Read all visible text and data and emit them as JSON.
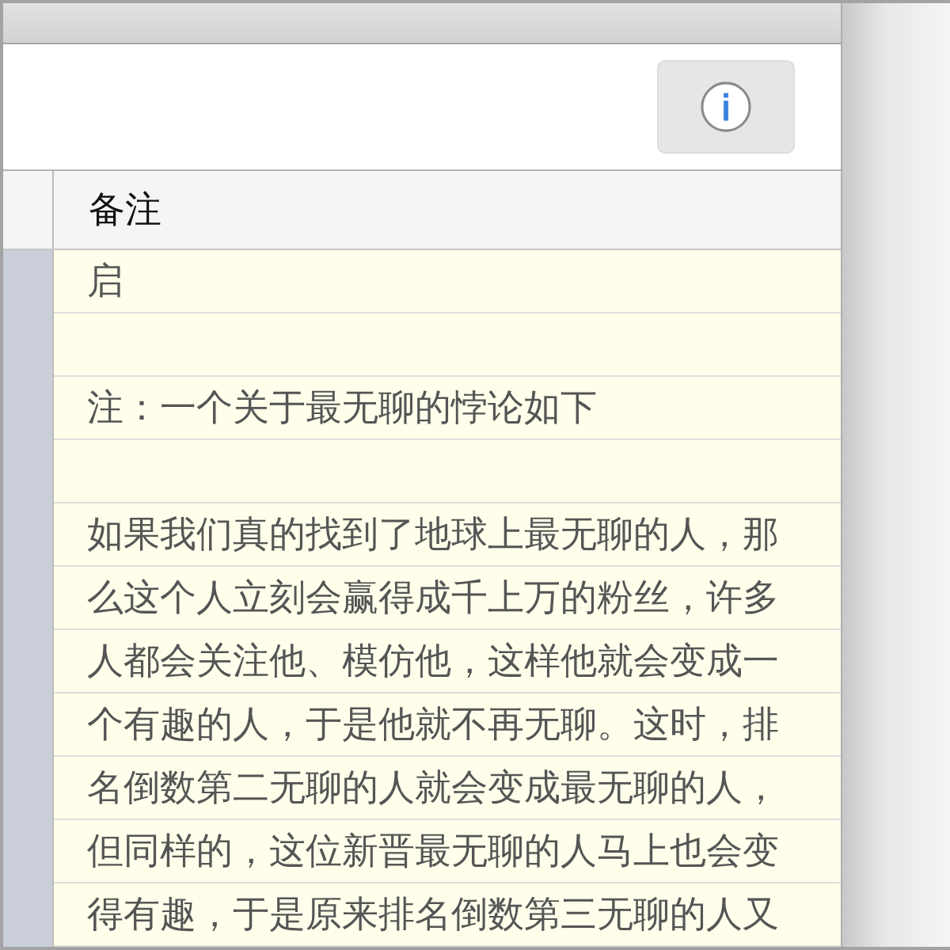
{
  "toolbar": {
    "buttons": [
      {
        "kind": "info"
      }
    ]
  },
  "table": {
    "columns": [
      "备注"
    ],
    "rows": [
      {
        "note": "启"
      },
      {},
      {
        "note": "注：一个关于最无聊的悖论如下"
      },
      {},
      {
        "note": "如果我们真的找到了地球上最无聊的人，那"
      },
      {
        "note": "么这个人立刻会赢得成千上万的粉丝，许多"
      },
      {
        "note": "人都会关注他、模仿他，这样他就会变成一"
      },
      {
        "note": "个有趣的人，于是他就不再无聊。这时，排"
      },
      {
        "note": "名倒数第二无聊的人就会变成最无聊的人，"
      },
      {
        "note": "但同样的，这位新晋最无聊的人马上也会变"
      },
      {
        "note": "得有趣，于是原来排名倒数第三无聊的人又"
      }
    ]
  }
}
